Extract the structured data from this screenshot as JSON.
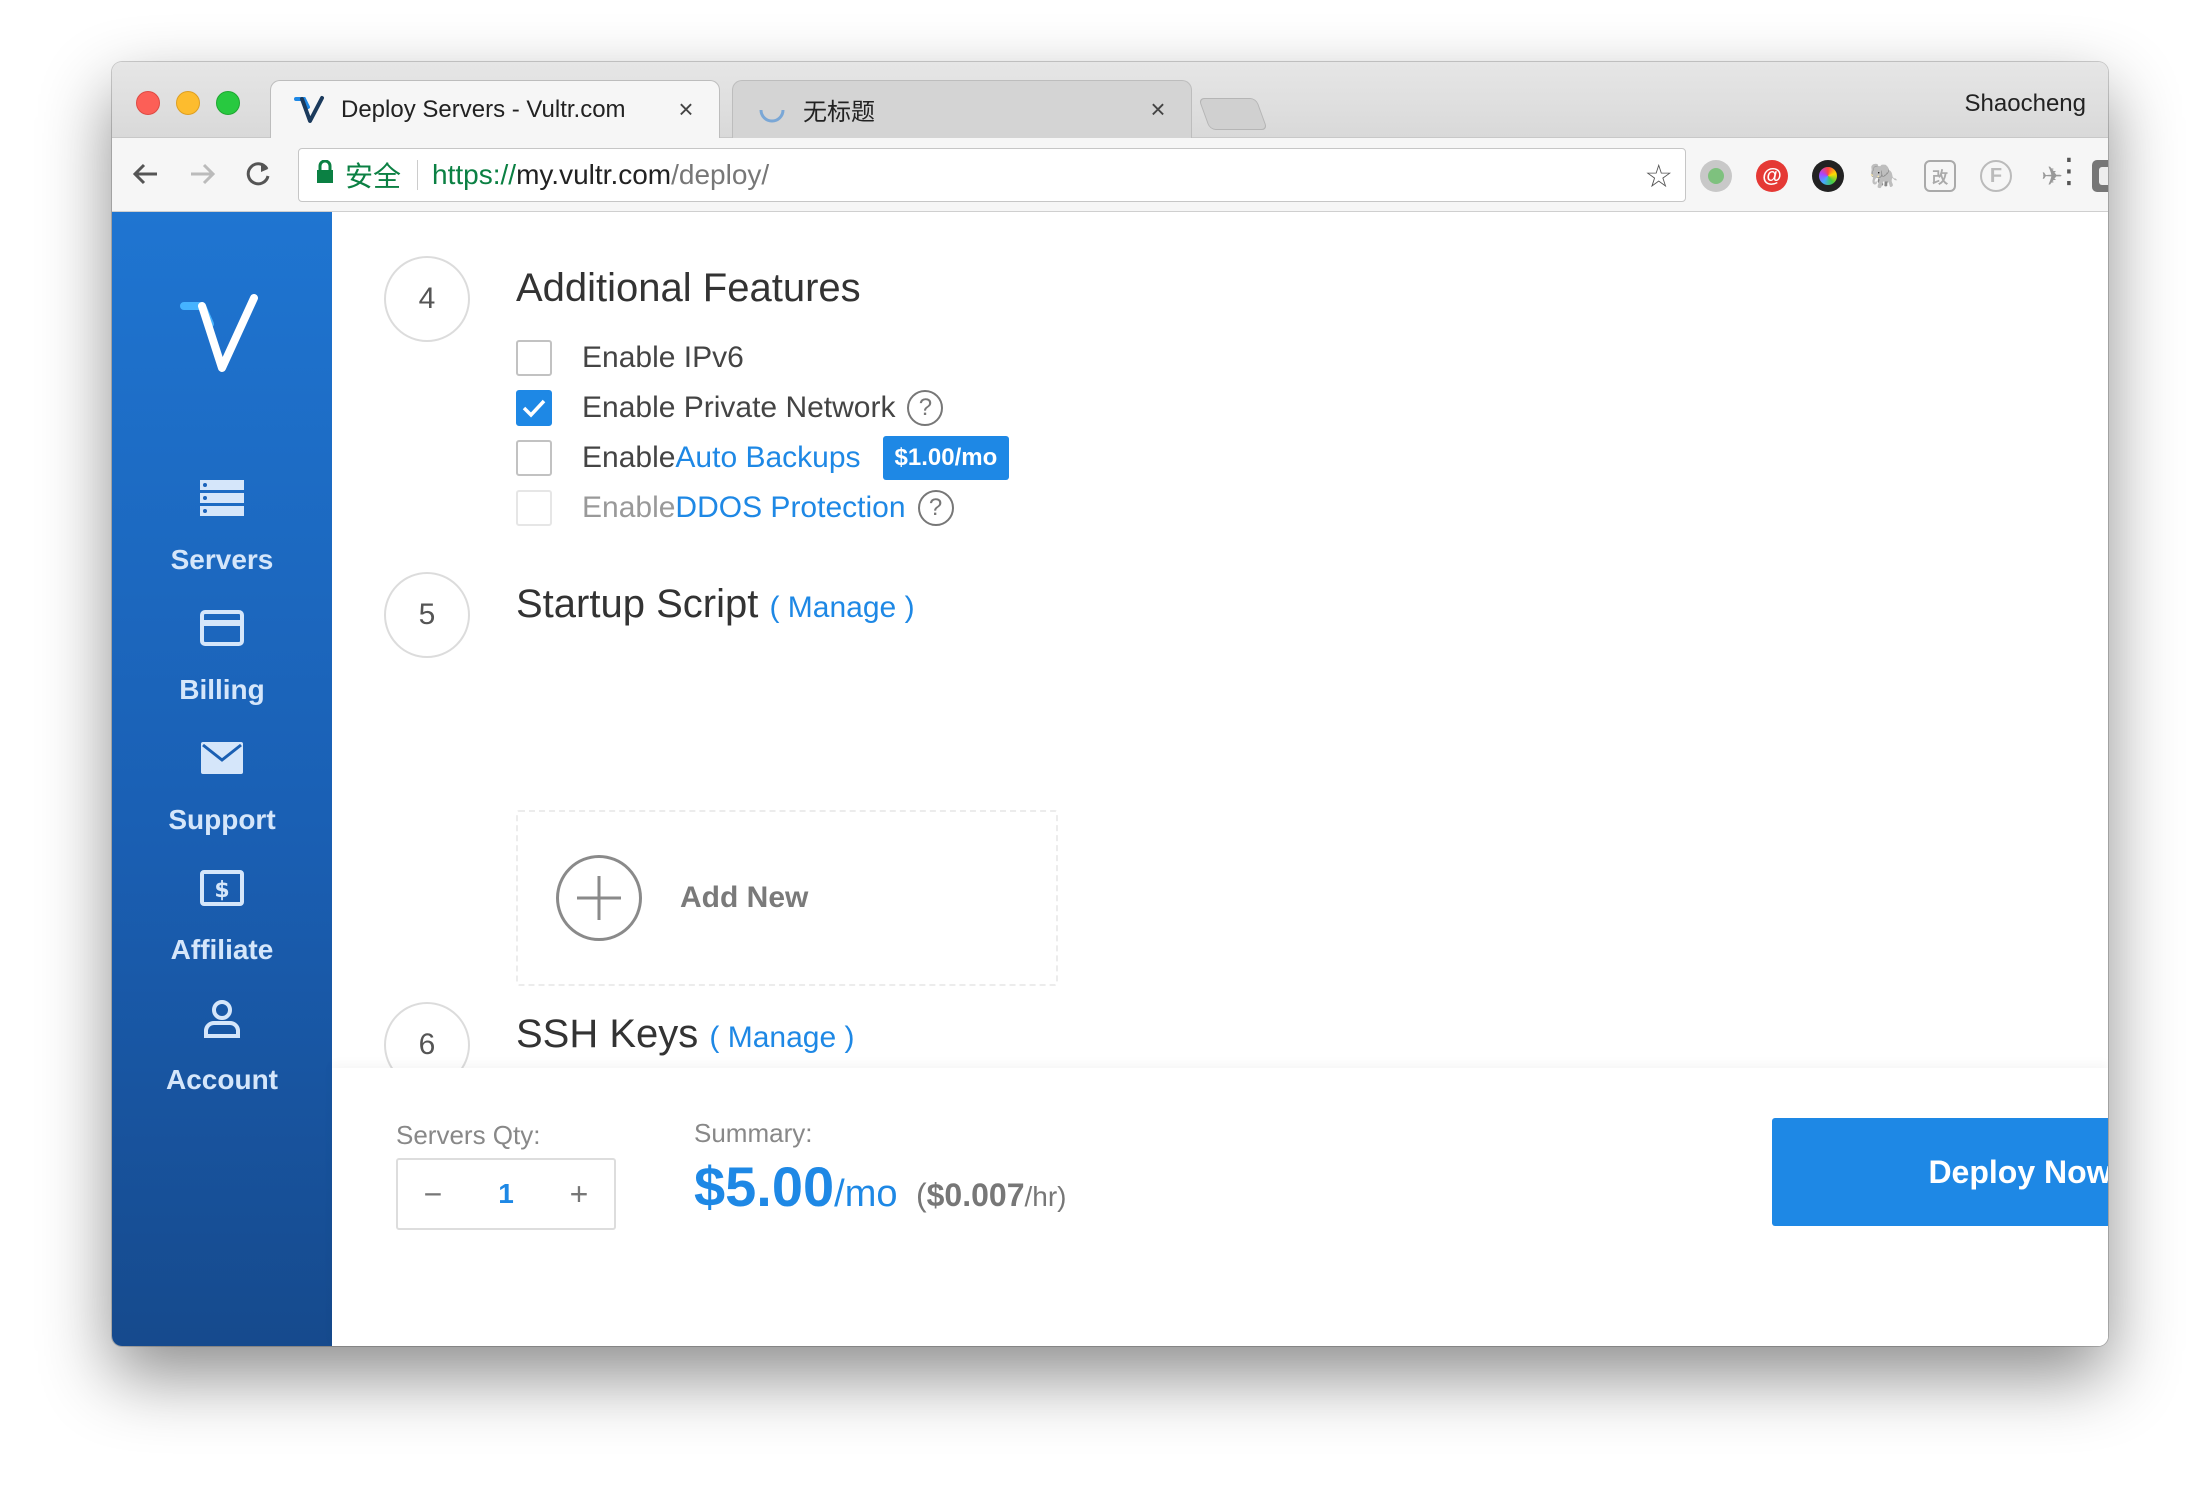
{
  "browser": {
    "tabs": [
      {
        "title": "Deploy Servers - Vultr.com",
        "close": "×"
      },
      {
        "title": "无标题",
        "close": "×"
      }
    ],
    "profile_name": "Shaocheng",
    "address": {
      "secure_label": "安全",
      "scheme": "https://",
      "host": "my.vultr.com",
      "path": "/deploy/"
    }
  },
  "sidebar": {
    "items": [
      {
        "label": "Servers",
        "icon": "servers-icon"
      },
      {
        "label": "Billing",
        "icon": "credit-card-icon"
      },
      {
        "label": "Support",
        "icon": "envelope-icon"
      },
      {
        "label": "Affiliate",
        "icon": "dollar-bill-icon"
      },
      {
        "label": "Account",
        "icon": "user-icon"
      }
    ]
  },
  "sections": {
    "additional_features": {
      "number": "4",
      "title": "Additional Features",
      "options": [
        {
          "prefix": "Enable IPv6",
          "checked": false
        },
        {
          "prefix": "Enable Private Network",
          "checked": true
        },
        {
          "prefix": "Enable ",
          "link": "Auto Backups",
          "badge": "$1.00/mo",
          "checked": false
        },
        {
          "prefix": "Enable ",
          "link": "DDOS Protection",
          "checked": false,
          "disabled": true
        }
      ]
    },
    "startup_script": {
      "number": "5",
      "title": "Startup Script",
      "manage_open": "(",
      "manage_label": "Manage",
      "manage_close": ")",
      "add_new_label": "Add New"
    },
    "ssh_keys": {
      "number": "6",
      "title": "SSH Keys",
      "manage_label": "( Manage )"
    }
  },
  "footer": {
    "qty_label": "Servers Qty:",
    "qty_value": "1",
    "minus": "−",
    "plus": "+",
    "summary_label": "Summary:",
    "price": "$5.00",
    "price_unit": "/mo",
    "hourly_open": "(",
    "hourly_price": "$0.007",
    "hourly_unit": "/hr)",
    "deploy_label": "Deploy Now"
  },
  "colors": {
    "accent": "#1e88e5",
    "sidebar_top": "#1f75d1",
    "sidebar_bottom": "#164a8d"
  }
}
